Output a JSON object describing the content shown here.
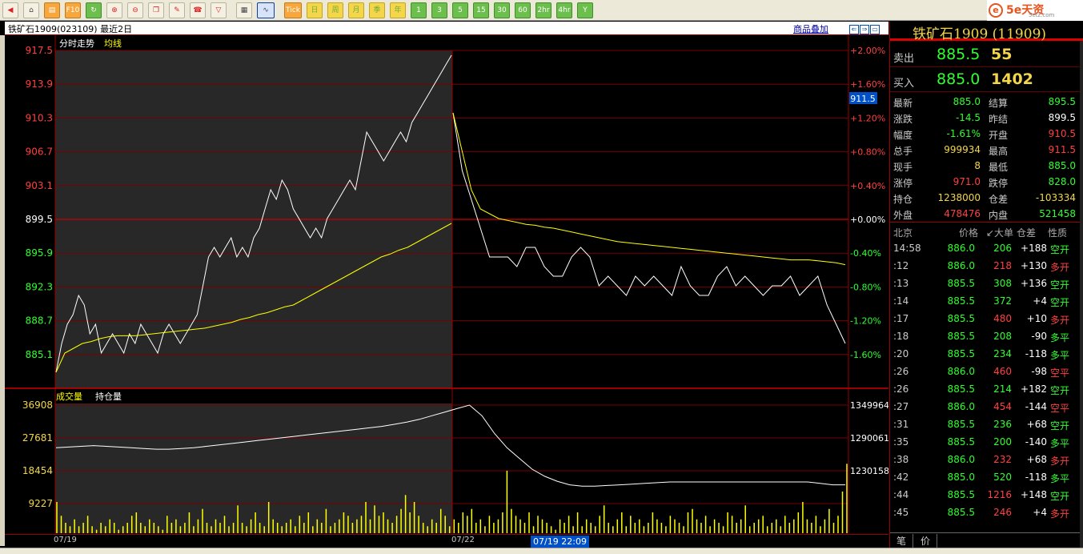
{
  "toolbar": {
    "buttons": [
      {
        "name": "back-icon",
        "glyph": "◀",
        "style": "red"
      },
      {
        "name": "home-icon",
        "glyph": "⌂",
        "style": ""
      },
      {
        "name": "news-icon",
        "glyph": "▤",
        "style": "orange"
      },
      {
        "name": "f10-icon",
        "glyph": "F10",
        "style": "orange"
      },
      {
        "name": "refresh-icon",
        "glyph": "↻",
        "style": "green"
      },
      {
        "name": "zoom-in-icon",
        "glyph": "⊕",
        "style": "red"
      },
      {
        "name": "zoom-out-icon",
        "glyph": "⊖",
        "style": "red"
      },
      {
        "name": "windows-icon",
        "glyph": "❐",
        "style": "red"
      },
      {
        "name": "pen-icon",
        "glyph": "✎",
        "style": "red"
      },
      {
        "name": "alarm-icon",
        "glyph": "☎",
        "style": "red"
      },
      {
        "name": "filter-icon",
        "glyph": "▽",
        "style": "red"
      },
      {
        "name": "table-icon",
        "glyph": "▦",
        "style": ""
      },
      {
        "name": "intraday-chart-icon",
        "glyph": "∿",
        "style": "sel"
      },
      {
        "name": "tick-icon",
        "glyph": "Tick",
        "style": "orange"
      },
      {
        "name": "day-period-icon",
        "glyph": "日",
        "style": "yellow"
      },
      {
        "name": "week-period-icon",
        "glyph": "周",
        "style": "yellow"
      },
      {
        "name": "month-period-icon",
        "glyph": "月",
        "style": "yellow"
      },
      {
        "name": "quarter-period-icon",
        "glyph": "季",
        "style": "yellow"
      },
      {
        "name": "year-period-icon",
        "glyph": "年",
        "style": "yellow"
      },
      {
        "name": "1min-period-icon",
        "glyph": "1",
        "style": "green"
      },
      {
        "name": "3min-period-icon",
        "glyph": "3",
        "style": "green"
      },
      {
        "name": "5min-period-icon",
        "glyph": "5",
        "style": "green"
      },
      {
        "name": "15min-period-icon",
        "glyph": "15",
        "style": "green"
      },
      {
        "name": "30min-period-icon",
        "glyph": "30",
        "style": "green"
      },
      {
        "name": "60min-period-icon",
        "glyph": "60",
        "style": "green"
      },
      {
        "name": "2hr-period-icon",
        "glyph": "2hr",
        "style": "green"
      },
      {
        "name": "4hr-period-icon",
        "glyph": "4hr",
        "style": "green"
      },
      {
        "name": "year-kline-icon",
        "glyph": "Y",
        "style": "green"
      }
    ],
    "logo_text": "5e天资",
    "logo_sub": "5etz.com"
  },
  "chart": {
    "title": "铁矿石1909(023109) 最近2日",
    "overlay_link": "商品叠加",
    "price_label": "分时走势",
    "avg_label": "均线",
    "volume_label": "成交量",
    "oi_label": "持仓量",
    "cursor_price": "911.5",
    "cursor_date": "07/19 22:09",
    "dates": [
      "07/19",
      "07/22"
    ]
  },
  "chart_data": {
    "type": "line",
    "title": "",
    "price_ticks": [
      "917.5",
      "913.9",
      "910.3",
      "906.7",
      "903.1",
      "899.5",
      "895.9",
      "892.3",
      "888.7",
      "885.1"
    ],
    "pct_ticks": [
      "+2.00%",
      "+1.60%",
      "+1.20%",
      "+0.80%",
      "+0.40%",
      "+0.00%",
      "-0.40%",
      "-0.80%",
      "-1.20%",
      "-1.60%"
    ],
    "volume_ticks": [
      "36908",
      "27681",
      "18454",
      "9227"
    ],
    "oi_ticks": [
      "1349964",
      "1290061",
      "1230158"
    ],
    "prev_settle": 899.5,
    "price_range": [
      884.0,
      917.5
    ],
    "series": [
      {
        "values": [
          884,
          887,
          889,
          890,
          892,
          891,
          888,
          889,
          886,
          887,
          888,
          887,
          886,
          888,
          887,
          889,
          888,
          887,
          886,
          888,
          889,
          888,
          887,
          888,
          889,
          890,
          893,
          896,
          897,
          896,
          897,
          898,
          896,
          897,
          896,
          898,
          899,
          901,
          903,
          902,
          904,
          903,
          901,
          900,
          899,
          898,
          899,
          898,
          900,
          901,
          902,
          903,
          904,
          903,
          906,
          909,
          908,
          907,
          906,
          907,
          908,
          909,
          908,
          910,
          911,
          912,
          913,
          914,
          915,
          916,
          917
        ],
        "color": "#fff"
      },
      {
        "values": [
          911,
          905,
          902,
          899,
          896,
          896,
          896,
          895,
          897,
          897,
          895,
          894,
          894,
          896,
          897,
          896,
          893,
          894,
          893,
          892,
          894,
          893,
          894,
          893,
          892,
          895,
          893,
          892,
          892,
          894,
          895,
          893,
          894,
          893,
          892,
          893,
          893,
          894,
          892,
          893,
          894,
          891,
          889,
          887
        ],
        "color": "#fff"
      },
      {
        "values": [
          884,
          886,
          886.5,
          887,
          887.2,
          887.5,
          887.7,
          887.8,
          887.8,
          887.8,
          887.9,
          888.0,
          888.1,
          888.2,
          888.3,
          888.4,
          888.5,
          888.6,
          888.8,
          889,
          889.2,
          889.5,
          889.7,
          890,
          890.2,
          890.5,
          890.8,
          891,
          891.5,
          892,
          892.5,
          893,
          893.5,
          894,
          894.5,
          895,
          895.5,
          896,
          896.3,
          896.7,
          897,
          897.5,
          898,
          898.5,
          899,
          899.5
        ],
        "color": "#ff0"
      },
      {
        "values": [
          911,
          907,
          903,
          901,
          900.5,
          900,
          899.8,
          899.6,
          899.4,
          899.3,
          899.1,
          899,
          898.8,
          898.6,
          898.4,
          898.2,
          898,
          897.8,
          897.6,
          897.5,
          897.4,
          897.3,
          897.2,
          897.1,
          897,
          896.9,
          896.8,
          896.7,
          896.6,
          896.5,
          896.4,
          896.3,
          896.2,
          896.1,
          896,
          895.9,
          895.8,
          895.7,
          895.7,
          895.7,
          895.6,
          895.5,
          895.4,
          895.2
        ],
        "color": "#ff0"
      }
    ],
    "volume": [
      9,
      5,
      3,
      2,
      4,
      2,
      3,
      5,
      2,
      1,
      3,
      2,
      4,
      3,
      1,
      2,
      3,
      5,
      6,
      3,
      2,
      4,
      3,
      2,
      1,
      5,
      3,
      4,
      2,
      3,
      6,
      2,
      4,
      7,
      3,
      2,
      4,
      3,
      5,
      2,
      3,
      8,
      3,
      2,
      4,
      6,
      3,
      2,
      9,
      4,
      3,
      2,
      3,
      4,
      2,
      5,
      3,
      6,
      2,
      4,
      3,
      7,
      2,
      3,
      4,
      6,
      5,
      3,
      4,
      5,
      9,
      4,
      8,
      5,
      6,
      4,
      3,
      5,
      7,
      11,
      6,
      9,
      5,
      3,
      2,
      4,
      3,
      7,
      5,
      2,
      4,
      3,
      6,
      5,
      7,
      3,
      4,
      2,
      5,
      3,
      4,
      6,
      18,
      7,
      5,
      4,
      3,
      6,
      2,
      5,
      4,
      3,
      2,
      1,
      4,
      3,
      5,
      2,
      6,
      2,
      4,
      3,
      2,
      5,
      8,
      3,
      2,
      4,
      6,
      2,
      5,
      3,
      4,
      2,
      3,
      6,
      4,
      3,
      2,
      5,
      4,
      3,
      2,
      6,
      7,
      4,
      3,
      5,
      2,
      4,
      3,
      2,
      6,
      5,
      3,
      4,
      8,
      2,
      3,
      4,
      5,
      2,
      3,
      4,
      2,
      5,
      3,
      4,
      6,
      9,
      4,
      3,
      5,
      2,
      4,
      7,
      3,
      5,
      12,
      20
    ],
    "open_interest": [
      1290000,
      1291000,
      1292000,
      1293000,
      1292000,
      1291000,
      1290000,
      1289000,
      1288000,
      1288000,
      1289000,
      1290000,
      1292000,
      1294000,
      1296000,
      1298000,
      1300000,
      1302000,
      1304000,
      1306000,
      1308000,
      1310000,
      1312000,
      1314000,
      1316000,
      1318000,
      1320000,
      1323000,
      1326000,
      1330000,
      1335000,
      1340000,
      1345000,
      1349964,
      1335000,
      1310000,
      1290000,
      1275000,
      1260000,
      1250000,
      1243000,
      1238000,
      1236000,
      1236000,
      1237000,
      1238000,
      1239000,
      1240000,
      1241000,
      1242000,
      1242000,
      1242000,
      1242000,
      1242000,
      1242000,
      1242000,
      1242000,
      1242000,
      1242000,
      1242000,
      1242000,
      1240000,
      1238000,
      1238000
    ]
  },
  "quote": {
    "title": "铁矿石1909 (11909)",
    "ask_label": "卖出",
    "ask_price": "885.5",
    "ask_vol": "55",
    "bid_label": "买入",
    "bid_price": "885.0",
    "bid_vol": "1402",
    "stats": [
      {
        "l1": "最新",
        "v1": "885.0",
        "c1": "#2fff2f",
        "l2": "结算",
        "v2": "895.5",
        "c2": "#2fff2f"
      },
      {
        "l1": "涨跌",
        "v1": "-14.5",
        "c1": "#2fff2f",
        "l2": "昨结",
        "v2": "899.5",
        "c2": "#ffffff"
      },
      {
        "l1": "幅度",
        "v1": "-1.61%",
        "c1": "#2fff2f",
        "l2": "开盘",
        "v2": "910.5",
        "c2": "#ff4040"
      },
      {
        "l1": "总手",
        "v1": "999934",
        "c1": "#f3d64a",
        "l2": "最高",
        "v2": "911.5",
        "c2": "#ff4040"
      },
      {
        "l1": "现手",
        "v1": "8",
        "c1": "#f3d64a",
        "l2": "最低",
        "v2": "885.0",
        "c2": "#2fff2f"
      },
      {
        "l1": "涨停",
        "v1": "971.0",
        "c1": "#ff4040",
        "l2": "跌停",
        "v2": "828.0",
        "c2": "#2fff2f"
      },
      {
        "l1": "持仓",
        "v1": "1238000",
        "c1": "#f3d64a",
        "l2": "仓差",
        "v2": "-103334",
        "c2": "#f3d64a"
      },
      {
        "l1": "外盘",
        "v1": "478476",
        "c1": "#ff4040",
        "l2": "内盘",
        "v2": "521458",
        "c2": "#2fff2f"
      }
    ],
    "ticks_header": {
      "time": "北京",
      "price": "价格",
      "vol": "↙大单",
      "diff": "仓差",
      "nature": "性质"
    },
    "ticks": [
      {
        "time": "14:58",
        "price": "886.0",
        "vol": "206",
        "vc": "#2fff2f",
        "diff": "+188",
        "nature": "空开",
        "nc": "#2fff2f"
      },
      {
        "time": ":12",
        "price": "886.0",
        "vol": "218",
        "vc": "#ff4040",
        "diff": "+130",
        "nature": "多开",
        "nc": "#ff4040"
      },
      {
        "time": ":13",
        "price": "885.5",
        "vol": "308",
        "vc": "#2fff2f",
        "diff": "+136",
        "nature": "空开",
        "nc": "#2fff2f"
      },
      {
        "time": ":14",
        "price": "885.5",
        "vol": "372",
        "vc": "#2fff2f",
        "diff": "+4",
        "nature": "空开",
        "nc": "#2fff2f"
      },
      {
        "time": ":17",
        "price": "885.5",
        "vol": "480",
        "vc": "#ff4040",
        "diff": "+10",
        "nature": "多开",
        "nc": "#ff4040"
      },
      {
        "time": ":18",
        "price": "885.5",
        "vol": "208",
        "vc": "#2fff2f",
        "diff": "-90",
        "nature": "多平",
        "nc": "#2fff2f"
      },
      {
        "time": ":20",
        "price": "885.5",
        "vol": "234",
        "vc": "#2fff2f",
        "diff": "-118",
        "nature": "多平",
        "nc": "#2fff2f"
      },
      {
        "time": ":26",
        "price": "886.0",
        "vol": "460",
        "vc": "#ff4040",
        "diff": "-98",
        "nature": "空平",
        "nc": "#ff4040"
      },
      {
        "time": ":26",
        "price": "885.5",
        "vol": "214",
        "vc": "#2fff2f",
        "diff": "+182",
        "nature": "空开",
        "nc": "#2fff2f"
      },
      {
        "time": ":27",
        "price": "886.0",
        "vol": "454",
        "vc": "#ff4040",
        "diff": "-144",
        "nature": "空平",
        "nc": "#ff4040"
      },
      {
        "time": ":31",
        "price": "885.5",
        "vol": "236",
        "vc": "#2fff2f",
        "diff": "+68",
        "nature": "空开",
        "nc": "#2fff2f"
      },
      {
        "time": ":35",
        "price": "885.5",
        "vol": "200",
        "vc": "#2fff2f",
        "diff": "-140",
        "nature": "多平",
        "nc": "#2fff2f"
      },
      {
        "time": ":38",
        "price": "886.0",
        "vol": "232",
        "vc": "#ff4040",
        "diff": "+68",
        "nature": "多开",
        "nc": "#ff4040"
      },
      {
        "time": ":42",
        "price": "885.0",
        "vol": "520",
        "vc": "#2fff2f",
        "diff": "-118",
        "nature": "多平",
        "nc": "#2fff2f"
      },
      {
        "time": ":44",
        "price": "885.5",
        "vol": "1216",
        "vc": "#ff4040",
        "diff": "+148",
        "nature": "空开",
        "nc": "#2fff2f"
      },
      {
        "time": ":45",
        "price": "885.5",
        "vol": "246",
        "vc": "#ff4040",
        "diff": "+4",
        "nature": "多开",
        "nc": "#ff4040"
      }
    ],
    "tabs": [
      "笔",
      "价"
    ]
  }
}
